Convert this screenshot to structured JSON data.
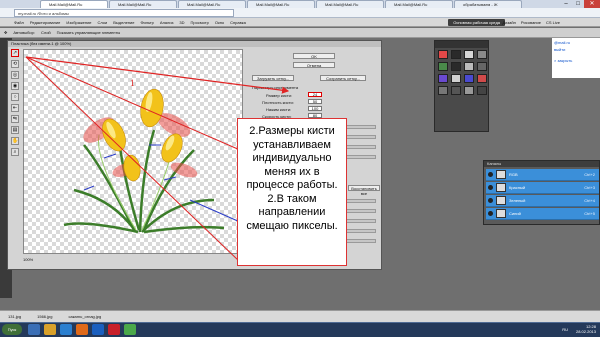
{
  "browser": {
    "tabs": [
      "Mail.Mail@Mail.Ru",
      "Mail.Mail@Mail.Ru",
      "Mail.Mail@Mail.Ru",
      "Mail.Mail@Mail.Ru",
      "Mail.Mail@Mail.Ru",
      "Mail.Mail@Mail.Ru",
      "обрабатываем - Ж"
    ],
    "address": "my.mail.ru /Фото и альбомы",
    "window_controls": [
      "–",
      "□",
      "✕"
    ]
  },
  "photoshop": {
    "menu": [
      "Файл",
      "Редактирование",
      "Изображение",
      "Слои",
      "Выделение",
      "Фильтр",
      "Анализ",
      "3D",
      "Просмотр",
      "Окно",
      "Справка"
    ],
    "workspace_button": "Основная рабочая среда",
    "workspace_links": [
      "Дизайн",
      "Рисование",
      "CS Live"
    ],
    "options": [
      "Автовыбор:",
      "Слой",
      "Показать управляющие элементы"
    ],
    "dialog_title": "Пластика (без имени-1 @ 100%)",
    "zoom": "100%",
    "panel": {
      "ok": "OK",
      "cancel": "Отмена",
      "load_mesh": "Загрузить сетку...",
      "save_mesh": "Сохранить сетку...",
      "tool_params": "Параметры инструмента",
      "params": [
        {
          "label": "Размер кисти:",
          "value": "24"
        },
        {
          "label": "Плотность кисти:",
          "value": "50"
        },
        {
          "label": "Нажим кисти:",
          "value": "100"
        },
        {
          "label": "Скорость кисти:",
          "value": "80"
        }
      ],
      "restore_all": "Восстановить все",
      "bottom_label": "Непрозрачность слоя:"
    }
  },
  "callout": {
    "arrow_label": "1",
    "text": "2.Размеры кисти устанавливаем индивидуально меняя их в процессе работы. 2.В таком направлении смещаю пикселы."
  },
  "layers_panel": {
    "title": "Каналы",
    "layers": [
      {
        "name": "RGB",
        "shortcut": "Ctrl+2"
      },
      {
        "name": "Красный",
        "shortcut": "Ctrl+3"
      },
      {
        "name": "Зеленый",
        "shortcut": "Ctrl+4"
      },
      {
        "name": "Синий",
        "shortcut": "Ctrl+5"
      }
    ]
  },
  "web_strip": {
    "links": [
      "@mail.ru",
      "выйти"
    ],
    "close": "× закрыть"
  },
  "files": [
    "131.jpg",
    "1566.jpg",
    "сакаmu_ornag.jpg"
  ],
  "taskbar": {
    "start": "Пуск",
    "lang": "RU",
    "time": "12:28",
    "date": "28.02.2013"
  },
  "colors": {
    "accent": "#3b8fd9",
    "callout_border": "#d33",
    "arrow": "#e02424",
    "tulip_yellow": "#f2c21a",
    "tulip_red": "#e8504a"
  }
}
